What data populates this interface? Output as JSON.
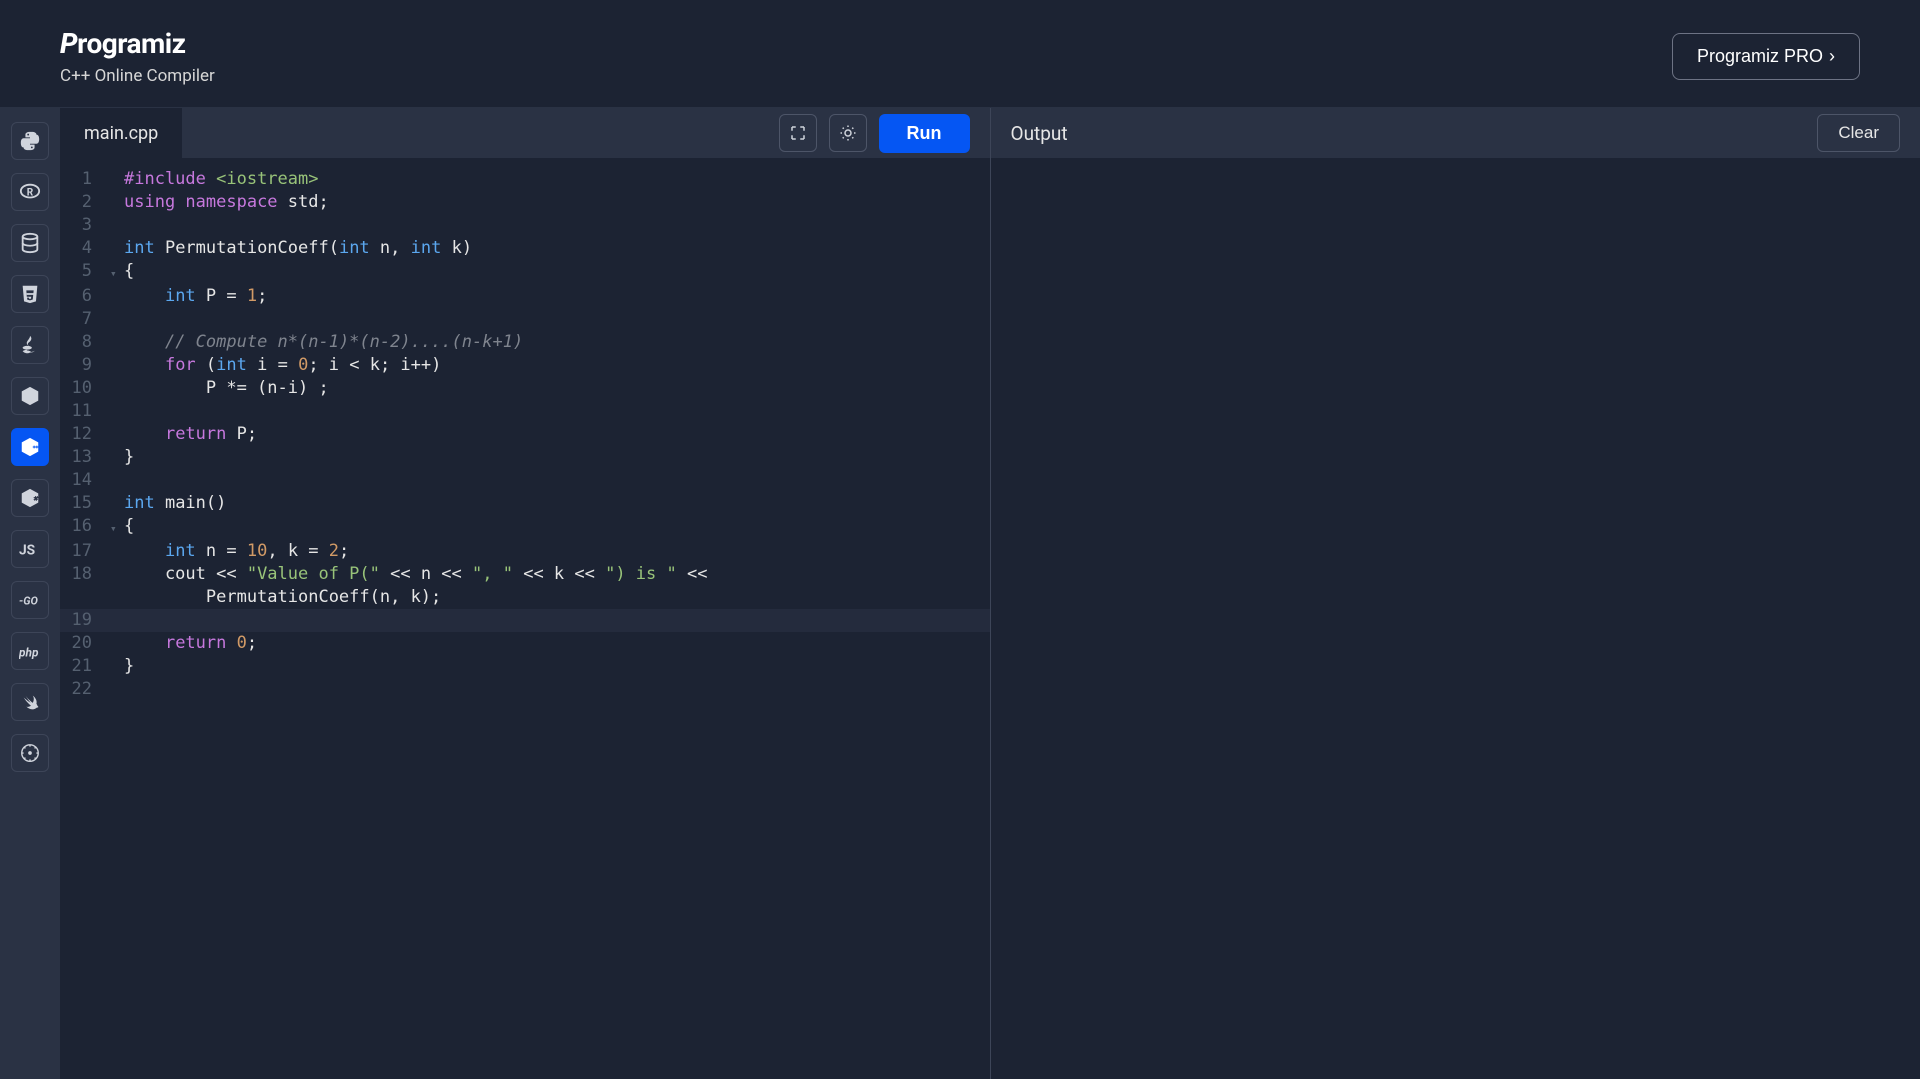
{
  "header": {
    "logo": "Programiz",
    "subtitle": "C++ Online Compiler",
    "pro_button": "Programiz PRO"
  },
  "sidebar": {
    "languages": [
      {
        "name": "python",
        "label": "py"
      },
      {
        "name": "r",
        "label": "R"
      },
      {
        "name": "sql",
        "label": "db"
      },
      {
        "name": "html",
        "label": "5"
      },
      {
        "name": "java",
        "label": "java"
      },
      {
        "name": "c",
        "label": "C"
      },
      {
        "name": "cpp",
        "label": "C",
        "active": true
      },
      {
        "name": "csharp",
        "label": "C"
      },
      {
        "name": "javascript",
        "label": "JS"
      },
      {
        "name": "go",
        "label": "GO"
      },
      {
        "name": "php",
        "label": "php"
      },
      {
        "name": "swift",
        "label": "sw"
      },
      {
        "name": "rust",
        "label": "rs"
      }
    ]
  },
  "editor": {
    "tab_name": "main.cpp",
    "run_label": "Run",
    "highlighted_line": 19,
    "code_lines": [
      {
        "n": 1,
        "tokens": [
          {
            "t": "#include ",
            "c": "tok-include"
          },
          {
            "t": "<iostream>",
            "c": "tok-header"
          }
        ]
      },
      {
        "n": 2,
        "tokens": [
          {
            "t": "using ",
            "c": "tok-keyword"
          },
          {
            "t": "namespace ",
            "c": "tok-keyword"
          },
          {
            "t": "std;",
            "c": ""
          }
        ]
      },
      {
        "n": 3,
        "tokens": []
      },
      {
        "n": 4,
        "tokens": [
          {
            "t": "int ",
            "c": "tok-keyword2"
          },
          {
            "t": "PermutationCoeff(",
            "c": ""
          },
          {
            "t": "int ",
            "c": "tok-keyword2"
          },
          {
            "t": "n, ",
            "c": ""
          },
          {
            "t": "int ",
            "c": "tok-keyword2"
          },
          {
            "t": "k)",
            "c": ""
          }
        ]
      },
      {
        "n": 5,
        "fold": true,
        "tokens": [
          {
            "t": "{",
            "c": ""
          }
        ]
      },
      {
        "n": 6,
        "tokens": [
          {
            "t": "    ",
            "c": ""
          },
          {
            "t": "int ",
            "c": "tok-keyword2"
          },
          {
            "t": "P = ",
            "c": ""
          },
          {
            "t": "1",
            "c": "tok-number"
          },
          {
            "t": ";",
            "c": ""
          }
        ]
      },
      {
        "n": 7,
        "tokens": []
      },
      {
        "n": 8,
        "tokens": [
          {
            "t": "    ",
            "c": ""
          },
          {
            "t": "// Compute n*(n-1)*(n-2)....(n-k+1)",
            "c": "tok-comment"
          }
        ]
      },
      {
        "n": 9,
        "tokens": [
          {
            "t": "    ",
            "c": ""
          },
          {
            "t": "for ",
            "c": "tok-keyword"
          },
          {
            "t": "(",
            "c": ""
          },
          {
            "t": "int ",
            "c": "tok-keyword2"
          },
          {
            "t": "i = ",
            "c": ""
          },
          {
            "t": "0",
            "c": "tok-number"
          },
          {
            "t": "; i < k; i++)",
            "c": ""
          }
        ]
      },
      {
        "n": 10,
        "tokens": [
          {
            "t": "        P *= (n-i) ;",
            "c": ""
          }
        ]
      },
      {
        "n": 11,
        "tokens": []
      },
      {
        "n": 12,
        "tokens": [
          {
            "t": "    ",
            "c": ""
          },
          {
            "t": "return ",
            "c": "tok-keyword"
          },
          {
            "t": "P;",
            "c": ""
          }
        ]
      },
      {
        "n": 13,
        "tokens": [
          {
            "t": "}",
            "c": ""
          }
        ]
      },
      {
        "n": 14,
        "tokens": []
      },
      {
        "n": 15,
        "tokens": [
          {
            "t": "int ",
            "c": "tok-keyword2"
          },
          {
            "t": "main()",
            "c": ""
          }
        ]
      },
      {
        "n": 16,
        "fold": true,
        "tokens": [
          {
            "t": "{",
            "c": ""
          }
        ]
      },
      {
        "n": 17,
        "tokens": [
          {
            "t": "    ",
            "c": ""
          },
          {
            "t": "int ",
            "c": "tok-keyword2"
          },
          {
            "t": "n = ",
            "c": ""
          },
          {
            "t": "10",
            "c": "tok-number"
          },
          {
            "t": ", k = ",
            "c": ""
          },
          {
            "t": "2",
            "c": "tok-number"
          },
          {
            "t": ";",
            "c": ""
          }
        ]
      },
      {
        "n": 18,
        "tokens": [
          {
            "t": "    cout << ",
            "c": ""
          },
          {
            "t": "\"Value of P(\"",
            "c": "tok-string"
          },
          {
            "t": " << n << ",
            "c": ""
          },
          {
            "t": "\", \"",
            "c": "tok-string"
          },
          {
            "t": " << k << ",
            "c": ""
          },
          {
            "t": "\") is \"",
            "c": "tok-string"
          },
          {
            "t": " <<",
            "c": ""
          }
        ]
      },
      {
        "n": null,
        "tokens": [
          {
            "t": "        PermutationCoeff(n, k);",
            "c": ""
          }
        ]
      },
      {
        "n": 19,
        "tokens": []
      },
      {
        "n": 20,
        "tokens": [
          {
            "t": "    ",
            "c": ""
          },
          {
            "t": "return ",
            "c": "tok-keyword"
          },
          {
            "t": "0",
            "c": "tok-number"
          },
          {
            "t": ";",
            "c": ""
          }
        ]
      },
      {
        "n": 21,
        "tokens": [
          {
            "t": "}",
            "c": ""
          }
        ]
      },
      {
        "n": 22,
        "tokens": []
      }
    ]
  },
  "output": {
    "label": "Output",
    "clear_label": "Clear",
    "content": ""
  }
}
